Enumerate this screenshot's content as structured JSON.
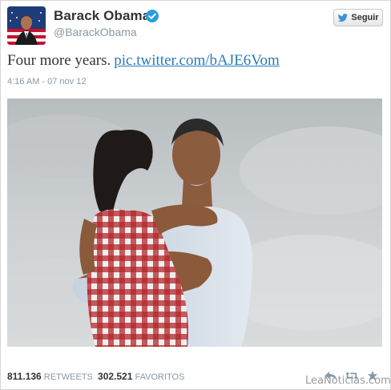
{
  "tweet": {
    "author_name": "Barack Obama",
    "handle": "@BarackObama",
    "follow_label": "Seguir",
    "text": "Four more years.",
    "link": "pic.twitter.com/bAJE6Vom",
    "timestamp": "4:16 AM - 07 nov 12",
    "retweets_count": "811.136",
    "retweets_label": "RETWEETS",
    "favorites_count": "302.521",
    "favorites_label": "FAVORITOS"
  },
  "watermark": "LeaNoticias.com",
  "icons": {
    "verified": "verified-badge-icon",
    "follow_bird": "twitter-bird-icon",
    "reply": "reply-icon",
    "retweet": "retweet-icon",
    "favorite": "star-icon"
  },
  "colors": {
    "link": "#2a7ab8",
    "verified": "#2b9cdc",
    "muted": "#8899a6"
  }
}
